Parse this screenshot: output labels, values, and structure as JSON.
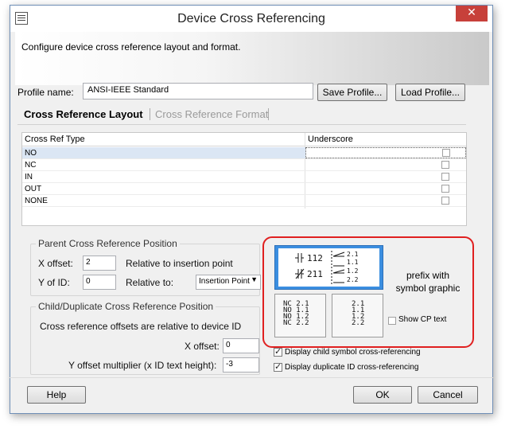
{
  "window": {
    "title": "Device Cross Referencing",
    "close_glyph": "✕"
  },
  "header": {
    "description": "Configure device cross reference layout and format."
  },
  "profile": {
    "label": "Profile name:",
    "value": "ANSI-IEEE Standard",
    "save_label": "Save Profile...",
    "load_label": "Load Profile..."
  },
  "tabs": [
    {
      "label": "Cross Reference Layout",
      "active": true
    },
    {
      "label": "Cross Reference Format",
      "active": false
    }
  ],
  "grid": {
    "columns": [
      "Cross Ref Type",
      "Underscore"
    ],
    "rows": [
      {
        "type": "NO",
        "underscore": false,
        "selected": true
      },
      {
        "type": "NC",
        "underscore": false,
        "selected": false
      },
      {
        "type": "IN",
        "underscore": false,
        "selected": false
      },
      {
        "type": "OUT",
        "underscore": false,
        "selected": false
      },
      {
        "type": "NONE",
        "underscore": false,
        "selected": false
      }
    ]
  },
  "parent_position": {
    "title": "Parent Cross Reference Position",
    "x_offset_label": "X offset:",
    "x_offset_value": "2",
    "x_relative_text": "Relative to insertion point",
    "y_label": "Y of ID:",
    "y_value": "0",
    "relative_to_label": "Relative to:",
    "relative_to_value": "Insertion Point"
  },
  "child_position": {
    "title": "Child/Duplicate Cross Reference Position",
    "note": "Cross reference offsets are relative to device ID",
    "x_offset_label": "X offset:",
    "x_offset_value": "0",
    "y_mult_label": "Y offset multiplier (x ID text height):",
    "y_mult_value": "-3"
  },
  "symbol_styles": {
    "graphic_left": [
      "112",
      "211"
    ],
    "graphic_right": [
      "2.1",
      "1.1",
      "1.2",
      "2.2"
    ],
    "text_prefix_lines": [
      "NC 2.1",
      "NO 1.1",
      "NO 1.2",
      "NC 2.2"
    ],
    "plain_lines": [
      "2.1",
      "1.1",
      "1.2",
      "2.2"
    ],
    "prefix_label_line1": "prefix with",
    "prefix_label_line2": "symbol graphic",
    "show_cp_label": "Show CP  text"
  },
  "options": {
    "child_symbol_label": "Display child symbol cross-referencing",
    "duplicate_id_label": "Display duplicate ID cross-referencing"
  },
  "footer": {
    "help_label": "Help",
    "ok_label": "OK",
    "cancel_label": "Cancel"
  }
}
